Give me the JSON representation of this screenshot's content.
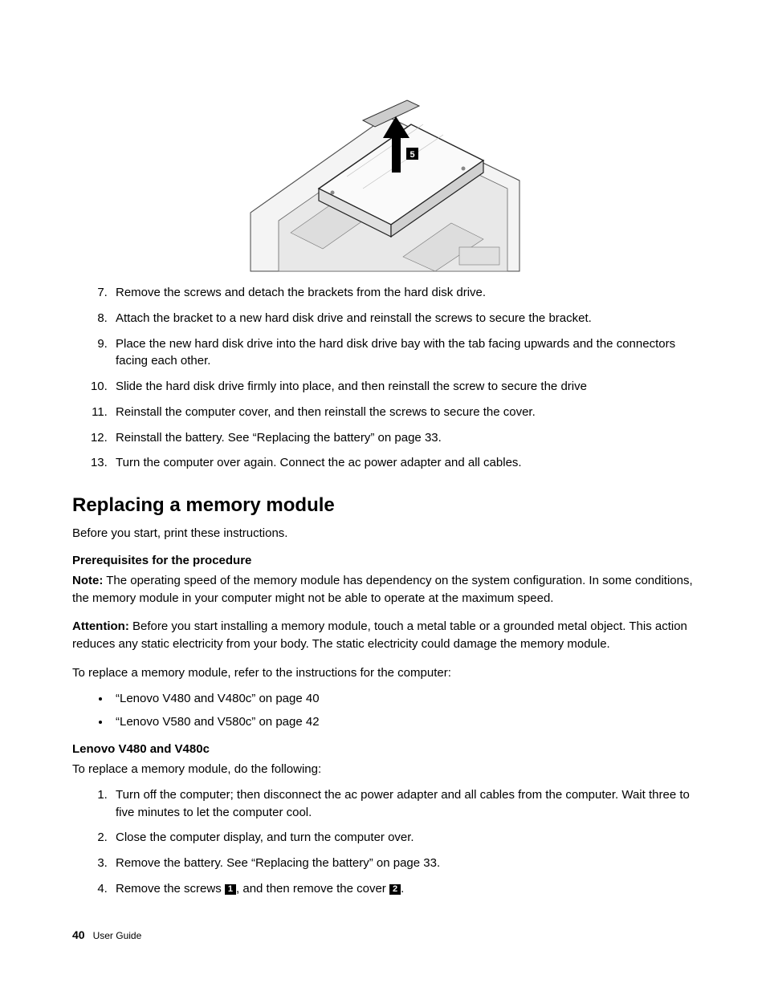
{
  "figure_callout": "5",
  "steps_top": [
    "Remove the screws and detach the brackets from the hard disk drive.",
    "Attach the bracket to a new hard disk drive and reinstall the screws to secure the bracket.",
    "Place the new hard disk drive into the hard disk drive bay with the tab facing upwards and the connectors facing each other.",
    "Slide the hard disk drive firmly into place, and then reinstall the screw to secure the drive",
    "Reinstall the computer cover, and then reinstall the screws to secure the cover.",
    "Reinstall the battery. See “Replacing the battery” on page 33.",
    "Turn the computer over again. Connect the ac power adapter and all cables."
  ],
  "section_heading": "Replacing a memory module",
  "intro": "Before you start, print these instructions.",
  "prereq_heading": "Prerequisites for the procedure",
  "note_label": "Note:",
  "note_text": " The operating speed of the memory module has dependency on the system configuration. In some conditions, the memory module in your computer might not be able to operate at the maximum speed.",
  "attention_label": "Attention:",
  "attention_text": " Before you start installing a memory module, touch a metal table or a grounded metal object. This action reduces any static electricity from your body. The static electricity could damage the memory module.",
  "refer_text": "To replace a memory module, refer to the instructions for the computer:",
  "refer_bullets": [
    "“Lenovo V480 and V480c” on page 40",
    "“Lenovo V580 and V580c” on page 42"
  ],
  "model_heading": "Lenovo V480 and V480c",
  "model_intro": "To replace a memory module, do the following:",
  "steps_bottom": [
    "Turn off the computer; then disconnect the ac power adapter and all cables from the computer. Wait three to five minutes to let the computer cool.",
    "Close the computer display, and turn the computer over.",
    "Remove the battery. See “Replacing the battery” on page 33."
  ],
  "step4_pre": "Remove the screws ",
  "step4_badge1": "1",
  "step4_mid": ", and then remove the cover ",
  "step4_badge2": "2",
  "step4_post": ".",
  "footer_page": "40",
  "footer_label": "User Guide"
}
